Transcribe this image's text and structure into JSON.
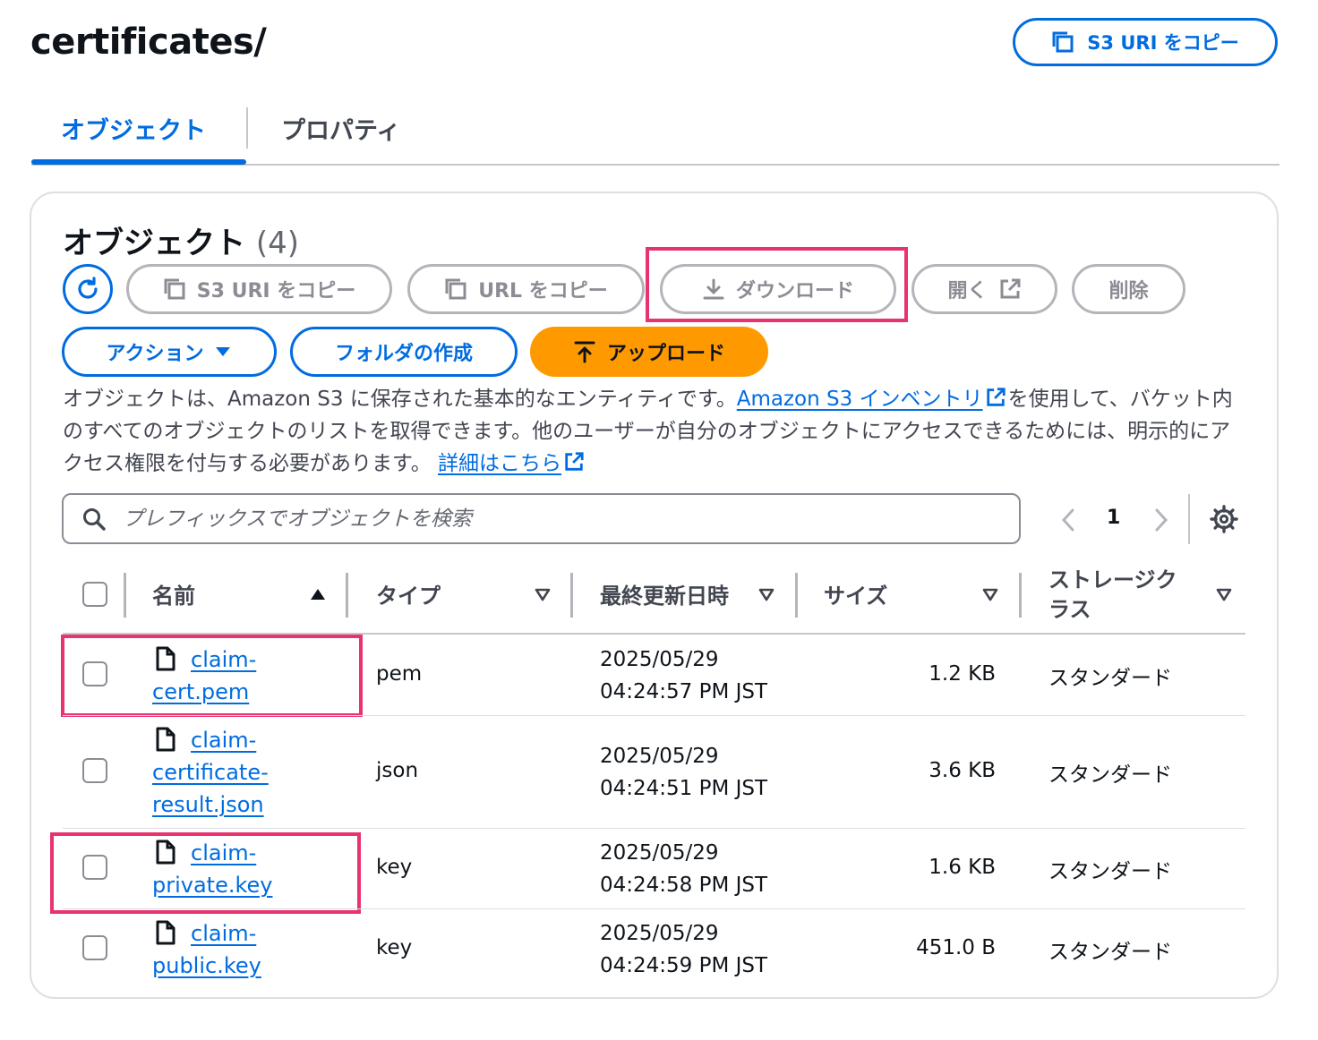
{
  "header": {
    "title": "certificates/",
    "copy_uri_label": "S3 URI をコピー"
  },
  "tabs": [
    {
      "label": "オブジェクト",
      "active": true
    },
    {
      "label": "プロパティ",
      "active": false
    }
  ],
  "objects_panel": {
    "title": "オブジェクト",
    "count": "(4)",
    "toolbar": {
      "copy_s3_uri": "S3 URI をコピー",
      "copy_url": "URL をコピー",
      "download": "ダウンロード",
      "open": "開く",
      "delete": "削除",
      "actions": "アクション",
      "create_folder": "フォルダの作成",
      "upload": "アップロード"
    },
    "description": {
      "part1": "オブジェクトは、Amazon S3 に保存された基本的なエンティティです。",
      "inventory_link": "Amazon S3 インベントリ",
      "part2": "を使用して、バケット内のすべてのオブジェクトのリストを取得できます。他のユーザーが自分のオブジェクトにアクセスできるためには、明示的にアクセス権限を付与する必要があります。",
      "details_link": "詳細はこちら"
    },
    "search": {
      "placeholder": "プレフィックスでオブジェクトを検索"
    },
    "pagination": {
      "current_page": "1"
    },
    "table": {
      "columns": [
        "名前",
        "タイプ",
        "最終更新日時",
        "サイズ",
        "ストレージクラス"
      ],
      "sort_column": "名前",
      "rows": [
        {
          "name": "claim-cert.pem",
          "type": "pem",
          "date": "2025/05/29",
          "time": "04:24:57 PM JST",
          "size": "1.2 KB",
          "storage_class": "スタンダード",
          "highlighted": true
        },
        {
          "name": "claim-certificate-result.json",
          "type": "json",
          "date": "2025/05/29",
          "time": "04:24:51 PM JST",
          "size": "3.6 KB",
          "storage_class": "スタンダード",
          "highlighted": false
        },
        {
          "name": "claim-private.key",
          "type": "key",
          "date": "2025/05/29",
          "time": "04:24:58 PM JST",
          "size": "1.6 KB",
          "storage_class": "スタンダード",
          "highlighted": true
        },
        {
          "name": "claim-public.key",
          "type": "key",
          "date": "2025/05/29",
          "time": "04:24:59 PM JST",
          "size": "451.0 B",
          "storage_class": "スタンダード",
          "highlighted": false
        }
      ]
    }
  },
  "colors": {
    "accent": "#006ce0",
    "primary_button": "#ff9900",
    "highlight": "#e8336f",
    "disabled": "#8c8c94"
  },
  "icons": [
    "copy-icon",
    "refresh-icon",
    "download-icon",
    "external-link-icon",
    "caret-down-icon",
    "upload-icon",
    "search-icon",
    "chevron-left-icon",
    "chevron-right-icon",
    "gear-icon",
    "sort-ascending-icon",
    "sort-descending-icon",
    "file-icon"
  ]
}
